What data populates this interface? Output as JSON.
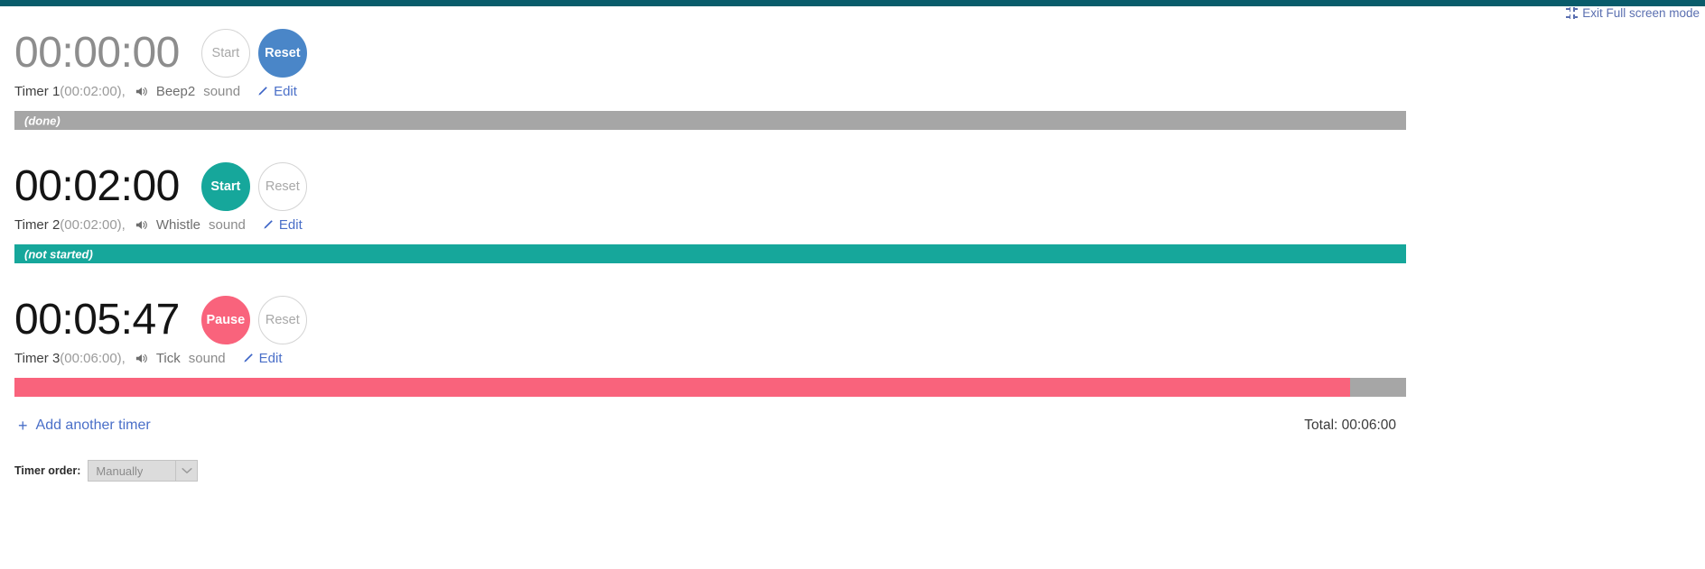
{
  "window": {
    "accent_bar_color": "#095c6b"
  },
  "header": {
    "exit_fullscreen_label": "Exit Full screen mode",
    "exit_fullscreen_icon": "fullscreen-exit-icon"
  },
  "timers": [
    {
      "display_time": "00:00:00",
      "display_state": "done",
      "primary_button": {
        "label": "Start",
        "style": "ghost",
        "enabled": false
      },
      "secondary_button": {
        "label": "Reset",
        "style": "primary-blue"
      },
      "accent_color": "#4a86c8",
      "name": "Timer 1",
      "duration": "(00:02:00),",
      "sound_icon": "speaker-icon",
      "sound_name": "Beep2",
      "sound_word": "sound",
      "edit_label": "Edit",
      "edit_icon": "pencil-icon",
      "bar": {
        "kind": "plain-gray",
        "fill_percent": 100,
        "bar_color": "#a6a6a6",
        "status_text": "(done)"
      }
    },
    {
      "display_time": "00:02:00",
      "display_state": "not-started",
      "primary_button": {
        "label": "Start",
        "style": "primary-teal",
        "enabled": true
      },
      "secondary_button": {
        "label": "Reset",
        "style": "ghost"
      },
      "accent_color": "#16a79b",
      "name": "Timer 2",
      "duration": "(00:02:00),",
      "sound_icon": "speaker-icon",
      "sound_name": "Whistle",
      "sound_word": "sound",
      "edit_label": "Edit",
      "edit_icon": "pencil-icon",
      "bar": {
        "kind": "teal-full",
        "fill_percent": 100,
        "bar_color": "#16a79b",
        "status_text": "(not started)"
      }
    },
    {
      "display_time": "00:05:47",
      "display_state": "running",
      "primary_button": {
        "label": "Pause",
        "style": "primary-pink",
        "enabled": true
      },
      "secondary_button": {
        "label": "Reset",
        "style": "ghost"
      },
      "accent_color": "#f9637c",
      "name": "Timer 3",
      "duration": "(00:06:00),",
      "sound_icon": "speaker-icon",
      "sound_name": "Tick",
      "sound_word": "sound",
      "edit_label": "Edit",
      "edit_icon": "pencil-icon",
      "bar": {
        "kind": "pink",
        "fill_percent": 96,
        "bar_color": "#f9637c",
        "track_color": "#a6a6a6",
        "status_text": ""
      }
    }
  ],
  "footer": {
    "add_timer_label": "Add another timer",
    "add_timer_icon": "plus-icon",
    "total_label": "Total: 00:06:00",
    "order_label": "Timer order:",
    "order_value": "Manually",
    "order_options": [
      "Manually"
    ],
    "order_chevron_icon": "chevron-down-icon"
  }
}
